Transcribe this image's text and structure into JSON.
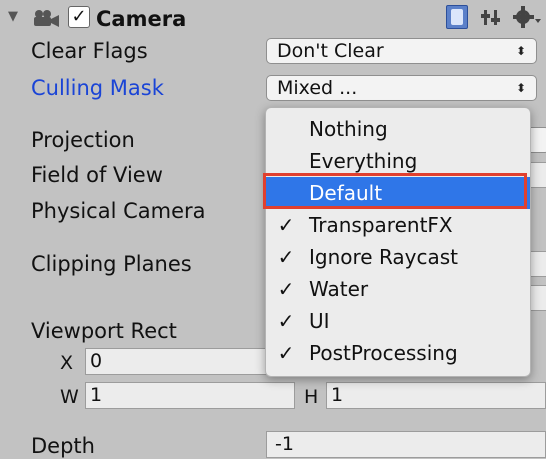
{
  "component": {
    "title": "Camera",
    "enabled_checkbox": "✓",
    "foldout_glyph": "▼"
  },
  "header_icons": [
    "help-icon",
    "presets-icon",
    "gear-icon"
  ],
  "fields": {
    "clear_flags": {
      "label": "Clear Flags",
      "value": "Don't Clear"
    },
    "culling_mask": {
      "label": "Culling Mask",
      "value": "Mixed ..."
    },
    "projection": {
      "label": "Projection"
    },
    "field_of_view": {
      "label": "Field of View"
    },
    "physical_camera": {
      "label": "Physical Camera"
    },
    "clipping_planes": {
      "label": "Clipping Planes"
    },
    "viewport_rect": {
      "label": "Viewport Rect",
      "x_label": "X",
      "x_value": "0",
      "w_label": "W",
      "w_value": "1",
      "h_label": "H",
      "h_value": "1"
    },
    "depth": {
      "label": "Depth",
      "value": "-1"
    }
  },
  "dropdown_arrow": "⬍",
  "culling_menu": {
    "items": [
      {
        "label": "Nothing",
        "checked": false,
        "selected": false
      },
      {
        "label": "Everything",
        "checked": false,
        "selected": false
      },
      {
        "label": "Default",
        "checked": false,
        "selected": true
      },
      {
        "label": "TransparentFX",
        "checked": true,
        "selected": false
      },
      {
        "label": "Ignore Raycast",
        "checked": true,
        "selected": false
      },
      {
        "label": "Water",
        "checked": true,
        "selected": false
      },
      {
        "label": "UI",
        "checked": true,
        "selected": false
      },
      {
        "label": "PostProcessing",
        "checked": true,
        "selected": false
      }
    ],
    "check_glyph": "✓"
  },
  "colors": {
    "panel_bg": "#c2c2c2",
    "selection_blue": "#2f76e8",
    "highlight_red": "#e0402f",
    "label_blue": "#1a44d6"
  }
}
